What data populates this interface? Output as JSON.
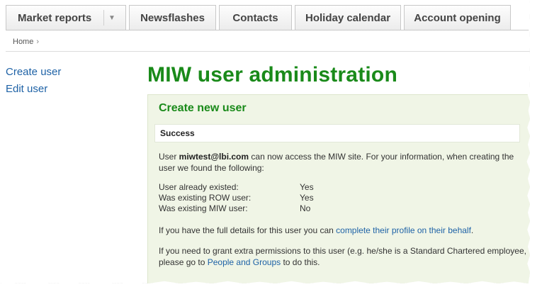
{
  "tabs": [
    {
      "label": "Market reports"
    },
    {
      "label": "Newsflashes"
    },
    {
      "label": "Contacts"
    },
    {
      "label": "Holiday calendar"
    },
    {
      "label": "Account opening"
    }
  ],
  "breadcrumb": {
    "home": "Home",
    "separator": "›"
  },
  "sidebar": {
    "items": [
      {
        "label": "Create user"
      },
      {
        "label": "Edit user"
      }
    ]
  },
  "page": {
    "title": "MIW user administration"
  },
  "panel": {
    "title": "Create new user",
    "status": "Success",
    "msg_prefix": "User ",
    "msg_user": "miwtest@lbi.com",
    "msg_suffix": " can now access the MIW site. For your information, when creating the user we found the following:",
    "details": [
      {
        "label": "User already existed:",
        "value": "Yes"
      },
      {
        "label": "Was existing ROW user:",
        "value": "Yes"
      },
      {
        "label": "Was existing MIW user:",
        "value": "No"
      }
    ],
    "profile_prefix": "If you have the full details for this user you can ",
    "profile_link": "complete their profile on their behalf",
    "profile_suffix": ".",
    "perm_prefix": "If you need to grant extra permissions to this user (e.g. he/she is a Standard Chartered employee, please go to ",
    "perm_link": "People and Groups",
    "perm_suffix": " to do this."
  },
  "colors": {
    "title_green": "#1a8a1a",
    "link_blue": "#1e62a6",
    "panel_bg": "#f0f5e6"
  }
}
